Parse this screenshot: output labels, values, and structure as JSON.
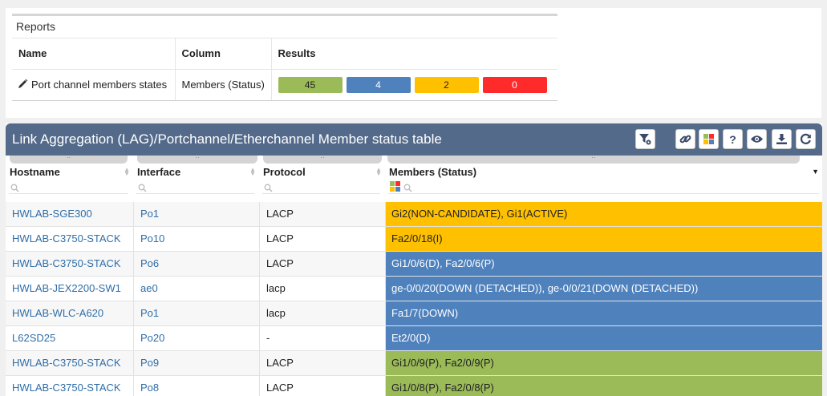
{
  "reports": {
    "title": "Reports",
    "columns": [
      "Name",
      "Column",
      "Results"
    ],
    "row": {
      "name": "Port channel members states",
      "column": "Members (Status)",
      "results": [
        {
          "value": "45",
          "color": "#9bbb59"
        },
        {
          "value": "4",
          "color": "#4f81bd"
        },
        {
          "value": "2",
          "color": "#ffc000"
        },
        {
          "value": "0",
          "color": "#ff2b2b"
        }
      ]
    }
  },
  "lag_table": {
    "title": "Link Aggregation (LAG)/Portchannel/Etherchannel Member status table",
    "toolbar": [
      "filter-settings-icon",
      "link-icon",
      "color-palette-icon",
      "help-icon",
      "eye-icon",
      "download-icon",
      "refresh-icon"
    ],
    "columns": [
      "Hostname",
      "Interface",
      "Protocol",
      "Members (Status)"
    ],
    "rows": [
      {
        "hostname": "HWLAB-SGE300",
        "interface": "Po1",
        "protocol": "LACP",
        "members": "Gi2(NON-CANDIDATE), Gi1(ACTIVE)",
        "status": "yellow"
      },
      {
        "hostname": "HWLAB-C3750-STACK",
        "interface": "Po10",
        "protocol": "LACP",
        "members": "Fa2/0/18(I)",
        "status": "yellow"
      },
      {
        "hostname": "HWLAB-C3750-STACK",
        "interface": "Po6",
        "protocol": "LACP",
        "members": "Gi1/0/6(D), Fa2/0/6(P)",
        "status": "blue"
      },
      {
        "hostname": "HWLAB-JEX2200-SW1",
        "interface": "ae0",
        "protocol": "lacp",
        "members": "ge-0/0/20(DOWN (DETACHED)), ge-0/0/21(DOWN (DETACHED))",
        "status": "blue"
      },
      {
        "hostname": "HWLAB-WLC-A620",
        "interface": "Po1",
        "protocol": "lacp",
        "members": "Fa1/7(DOWN)",
        "status": "blue"
      },
      {
        "hostname": "L62SD25",
        "interface": "Po20",
        "protocol": "-",
        "members": "Et2/0(D)",
        "status": "blue"
      },
      {
        "hostname": "HWLAB-C3750-STACK",
        "interface": "Po9",
        "protocol": "LACP",
        "members": "Gi1/0/9(P), Fa2/0/9(P)",
        "status": "green"
      },
      {
        "hostname": "HWLAB-C3750-STACK",
        "interface": "Po8",
        "protocol": "LACP",
        "members": "Gi1/0/8(P), Fa2/0/8(P)",
        "status": "green"
      }
    ]
  },
  "colors": {
    "header_bg": "#536a8a",
    "link": "#2f6ea8",
    "status_yellow": "#ffc000",
    "status_blue": "#4f81bd",
    "status_green": "#9bbb59",
    "status_red": "#ff2b2b"
  }
}
